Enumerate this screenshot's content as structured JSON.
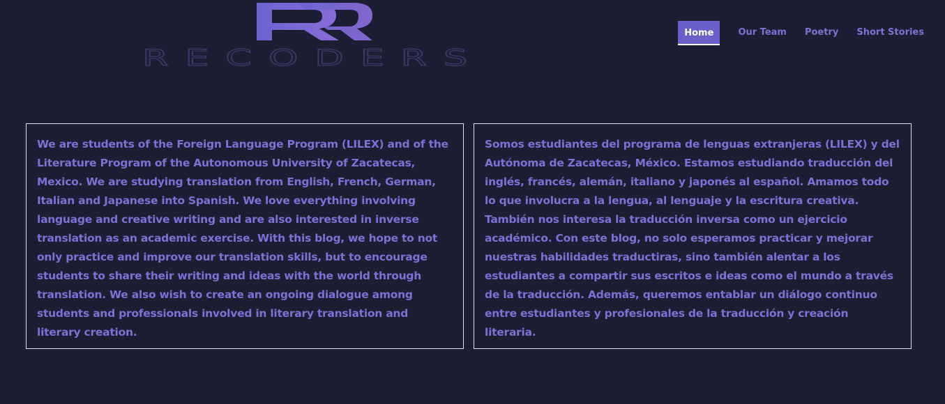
{
  "brand": {
    "logo_text": "RECODERS",
    "logo_mark": "R"
  },
  "nav": {
    "items": [
      {
        "label": "Home",
        "active": true
      },
      {
        "label": "Our Team",
        "active": false
      },
      {
        "label": "Poetry",
        "active": false
      },
      {
        "label": "Short Stories",
        "active": false
      }
    ]
  },
  "content": {
    "english": "We are students of the Foreign Language Program (LILEX) and of the Literature Program of the Autonomous University of Zacatecas, Mexico. We are studying translation from English, French, German, Italian and Japanese into Spanish. We love everything involving language and creative writing and are also interested in inverse translation as an academic exercise. With this blog, we hope to not only practice and improve our translation skills, but to encourage students to share their writing and ideas with the world through translation. We also wish to create an ongoing dialogue among students and professionals involved in literary translation and literary creation.",
    "spanish": "Somos estudiantes del programa de lenguas extranjeras (LILEX) y del Autónoma de Zacatecas, México. Estamos estudiando traducción del inglés, francés, alemán, italiano y japonés al español. Amamos todo lo que involucra a la lengua, al lenguaje y la escritura creativa. También nos interesa la traducción inversa como un ejercicio académico. Con este blog, no solo esperamos practicar y mejorar nuestras habilidades traductiras, sino también alentar a los estudiantes a compartir sus escritos e ideas como el mundo a través de la traducción. Además, queremos entablar un diálogo continuo entre estudiantes y profesionales de la traducción y creación literaria."
  },
  "colors": {
    "background": "#1c1e33",
    "accent": "#7b72d6",
    "active_nav": "#6a60c9",
    "border": "#e3e3ea"
  }
}
